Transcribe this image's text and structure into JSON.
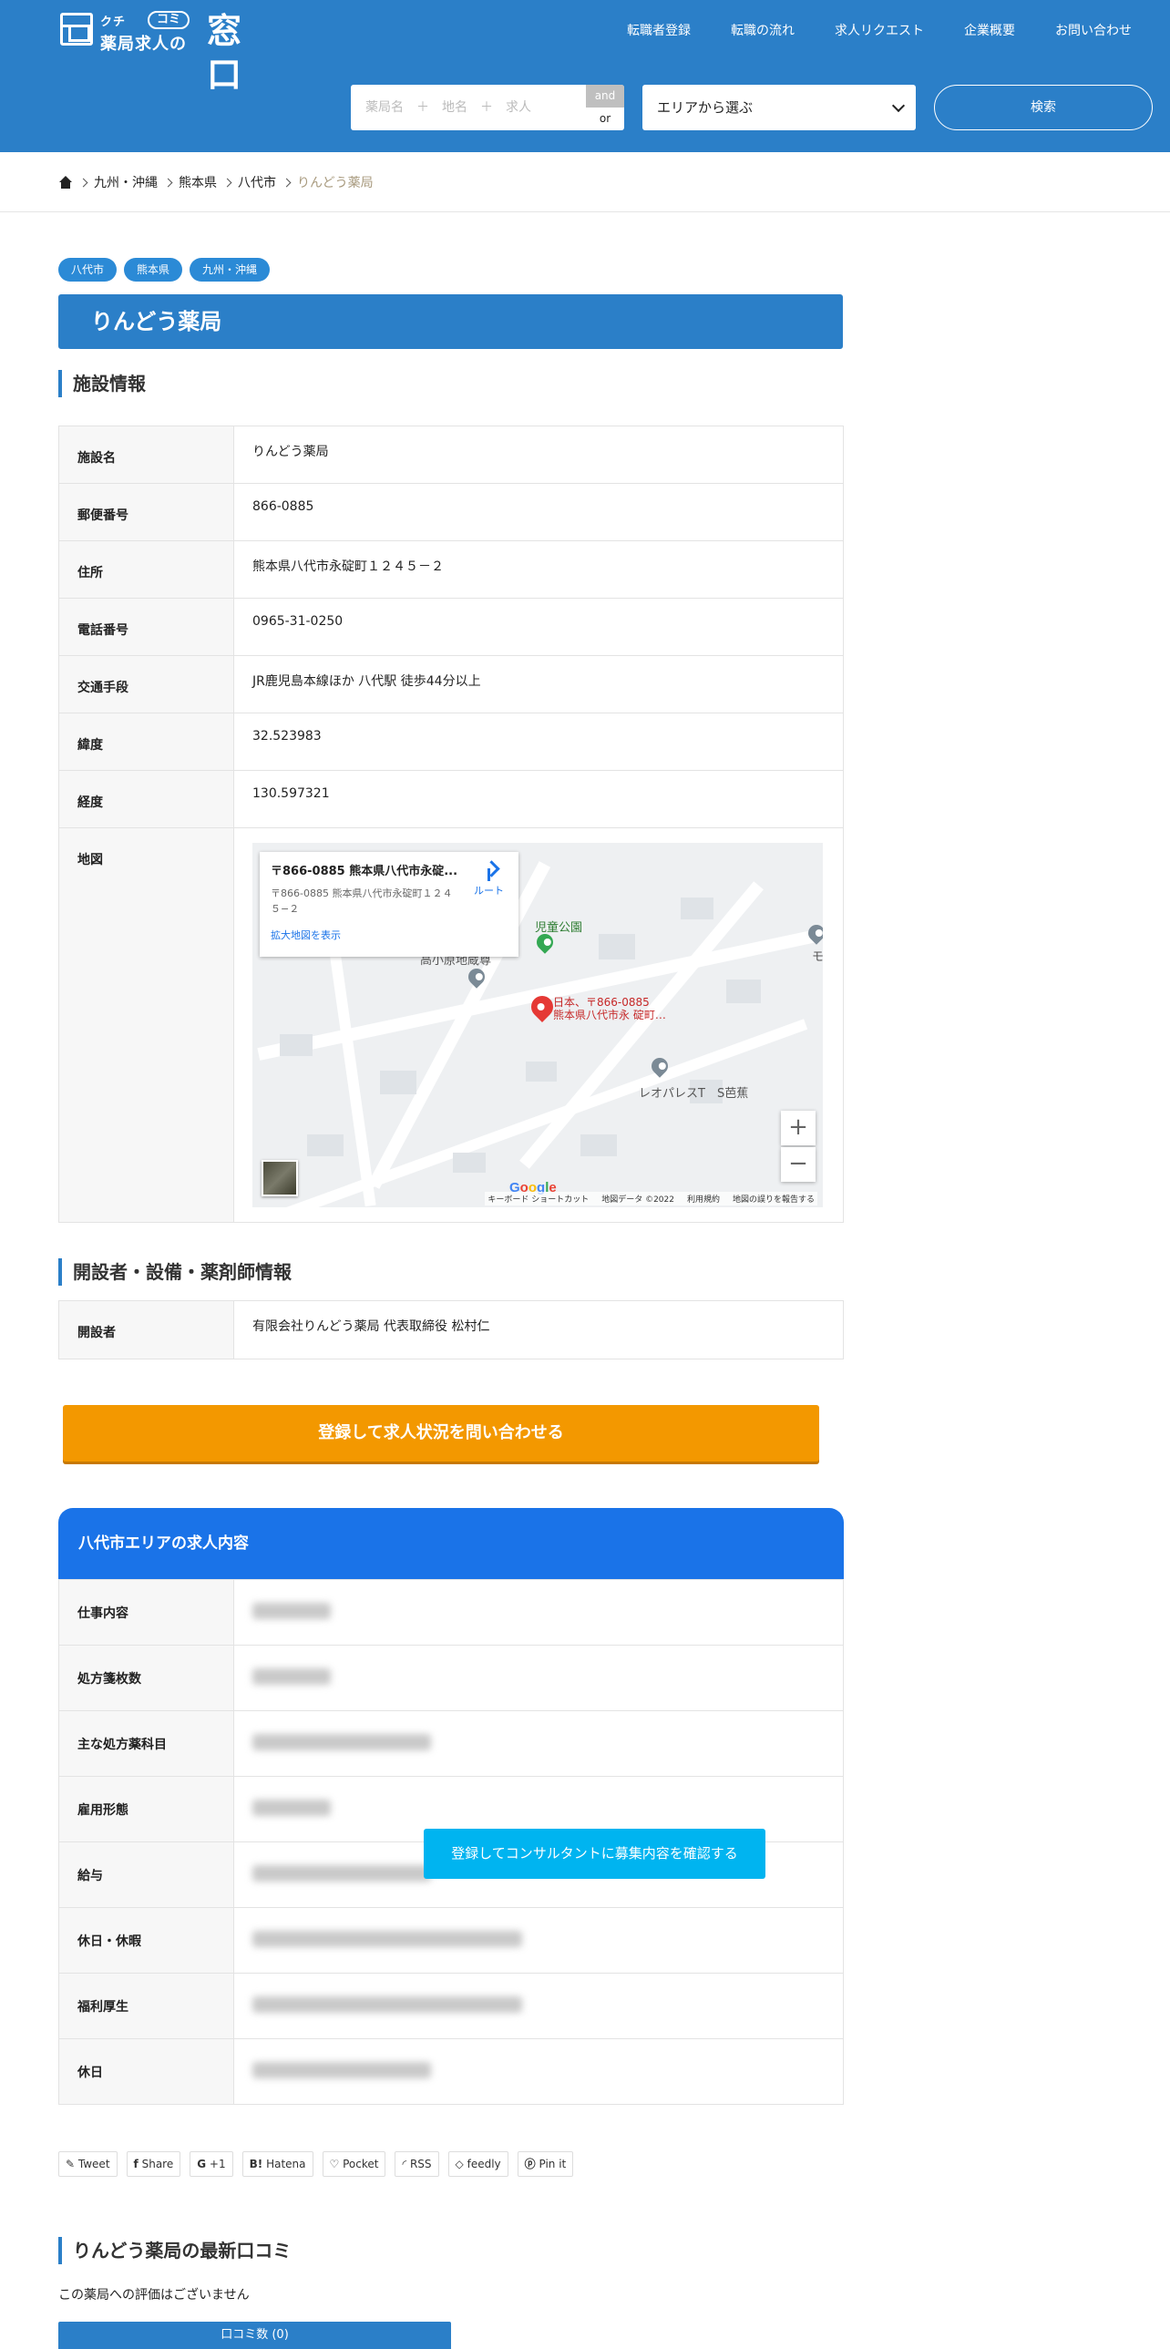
{
  "logo": {
    "small": "クチ",
    "badge": "コミ",
    "main": "薬局求人の",
    "big": "窓口"
  },
  "nav": [
    "転職者登録",
    "転職の流れ",
    "求人リクエスト",
    "企業概要",
    "お問い合わせ"
  ],
  "search": {
    "placeholder": "薬局名　＋　地名　＋　求人",
    "and": "and",
    "or": "or",
    "area": "エリアから選ぶ",
    "button": "検索"
  },
  "breadcrumb": [
    "九州・沖縄",
    "熊本県",
    "八代市",
    "りんどう薬局"
  ],
  "tags": [
    "八代市",
    "熊本県",
    "九州・沖縄"
  ],
  "title": "りんどう薬局",
  "facility": {
    "heading": "施設情報",
    "rows": [
      {
        "label": "施設名",
        "value": "りんどう薬局"
      },
      {
        "label": "郵便番号",
        "value": "866-0885"
      },
      {
        "label": "住所",
        "value": "熊本県八代市永碇町１２４５－２"
      },
      {
        "label": "電話番号",
        "value": "0965-31-0250"
      },
      {
        "label": "交通手段",
        "value": "JR鹿児島本線ほか 八代駅 徒歩44分以上"
      },
      {
        "label": "緯度",
        "value": "32.523983"
      },
      {
        "label": "経度",
        "value": "130.597321"
      },
      {
        "label": "地図",
        "value": ""
      }
    ]
  },
  "map": {
    "card_title": "〒866-0885 熊本県八代市永碇...",
    "card_address": "〒866-0885 熊本県八代市永碇町１２４５−２",
    "card_link": "拡大地図を表示",
    "route": "ルート",
    "pin_label_1": "日本、〒866-0885",
    "pin_label_2": "熊本県八代市永 碇町…",
    "place_1": "高小原地蔵尊",
    "place_2": "児童公園",
    "place_3": "レオパレスT　S芭蕉",
    "place_4": "モ",
    "zoom_in": "+",
    "zoom_out": "−",
    "google": "Google",
    "attrib": [
      "キーボード ショートカット",
      "地図データ ©2022",
      "利用規約",
      "地図の誤りを報告する"
    ]
  },
  "opener": {
    "heading": "開設者・設備・薬剤師情報",
    "rows": [
      {
        "label": "開設者",
        "value": "有限会社りんどう薬局 代表取締役 松村仁"
      }
    ]
  },
  "cta": "登録して求人状況を問い合わせる",
  "jobs": {
    "heading": "八代市エリアの求人内容",
    "rows": [
      "仕事内容",
      "処方箋枚数",
      "主な処方薬科目",
      "雇用形態",
      "給与",
      "休日・休暇",
      "福利厚生",
      "休日"
    ],
    "consult_button": "登録してコンサルタントに募集内容を確認する"
  },
  "share": [
    "Tweet",
    "Share",
    "+1",
    "Hatena",
    "Pocket",
    "RSS",
    "feedly",
    "Pin it"
  ],
  "reviews": {
    "heading": "りんどう薬局の最新口コミ",
    "empty": "この薬局への評価はございません",
    "count": "口コミ数 (0)"
  },
  "colors": {
    "primary": "#2b7fc8",
    "accent": "#f39800",
    "job_head": "#1a73e8",
    "consult": "#00b4f0"
  }
}
